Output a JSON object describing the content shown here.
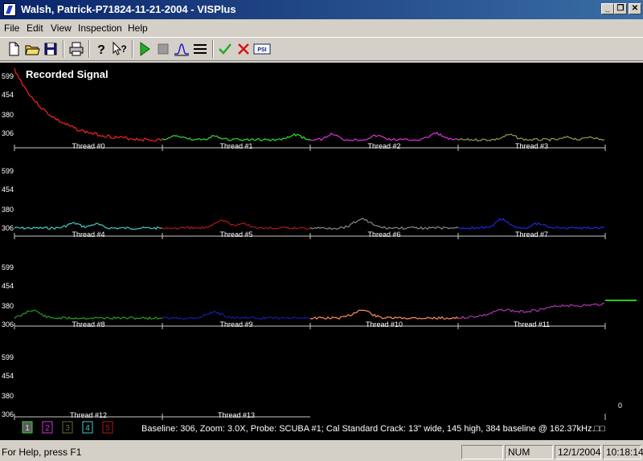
{
  "window": {
    "title": "Walsh, Patrick-P71824-11-21-2004 - VISPlus"
  },
  "menu": [
    "File",
    "Edit",
    "View",
    "Inspection",
    "Help"
  ],
  "toolbar": {
    "groups": [
      [
        "new-file-icon",
        "open-folder-icon",
        "save-icon"
      ],
      [
        "print-icon"
      ],
      [
        "help-icon",
        "context-help-icon"
      ],
      [
        "play-icon",
        "stop-icon",
        "waveform-icon",
        "lines-icon"
      ],
      [
        "check-icon",
        "cancel-x-icon",
        "psi-icon"
      ]
    ],
    "psi_label": "PSI"
  },
  "plot": {
    "title": "Recorded Signal",
    "y_ticks": [
      "599",
      "454",
      "380",
      "306"
    ],
    "threads": [
      {
        "label": "Thread #0",
        "color": "#ff2020"
      },
      {
        "label": "Thread #1",
        "color": "#33dd33"
      },
      {
        "label": "Thread #2",
        "color": "#dd33dd"
      },
      {
        "label": "Thread #3",
        "color": "#9a9a50"
      },
      {
        "label": "Thread #4",
        "color": "#44cccc"
      },
      {
        "label": "Thread #5",
        "color": "#b01818"
      },
      {
        "label": "Thread #6",
        "color": "#8c8c8c"
      },
      {
        "label": "Thread #7",
        "color": "#1a2ae0"
      },
      {
        "label": "Thread #8",
        "color": "#22a022"
      },
      {
        "label": "Thread #9",
        "color": "#1a1aa8"
      },
      {
        "label": "Thread #10",
        "color": "#ff8c5a"
      },
      {
        "label": "Thread #11",
        "color": "#b033b0"
      },
      {
        "label": "Thread #12",
        "color": "#2e8caa"
      },
      {
        "label": "Thread #13",
        "color": "#ffffff"
      }
    ],
    "side_value": "0",
    "legend_buttons": [
      {
        "label": "1",
        "color": "#33dd33",
        "selected": true
      },
      {
        "label": "2",
        "color": "#dd33dd",
        "selected": false
      },
      {
        "label": "3",
        "color": "#6a6a3a",
        "selected": false
      },
      {
        "label": "4",
        "color": "#44cccc",
        "selected": false
      },
      {
        "label": "5",
        "color": "#b01818",
        "selected": false
      }
    ],
    "info": "Baseline: 306, Zoom: 3.0X, Probe: SCUBA #1; Cal Standard Crack: 13\" wide, 145 high, 384 baseline @ 162.37kHz.□□"
  },
  "status": {
    "help": "For Help, press F1",
    "num": "NUM",
    "date": "12/1/2004",
    "time": "10:18:14"
  }
}
